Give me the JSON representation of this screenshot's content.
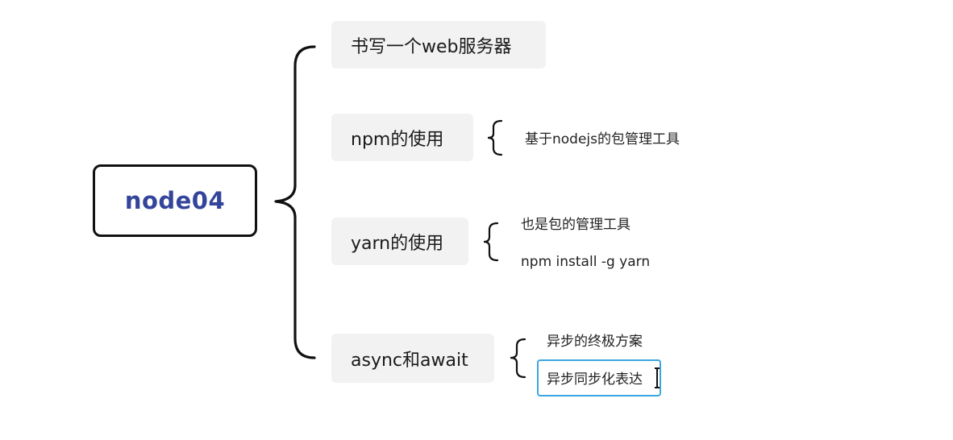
{
  "diagram": {
    "root": {
      "label": "node04"
    },
    "topics": [
      {
        "label": "书写一个web服务器",
        "children": []
      },
      {
        "label": "npm的使用",
        "children": [
          "基于nodejs的包管理工具"
        ]
      },
      {
        "label": "yarn的使用",
        "children": [
          "也是包的管理工具",
          "npm install -g yarn"
        ]
      },
      {
        "label": "async和await",
        "children": [
          "异步的终极方案",
          "异步同步化表达"
        ]
      }
    ]
  },
  "colors": {
    "root_text": "#33449a",
    "topic_bg": "#f2f2f2",
    "selection_border": "#3ba7e0",
    "line": "#111111"
  }
}
